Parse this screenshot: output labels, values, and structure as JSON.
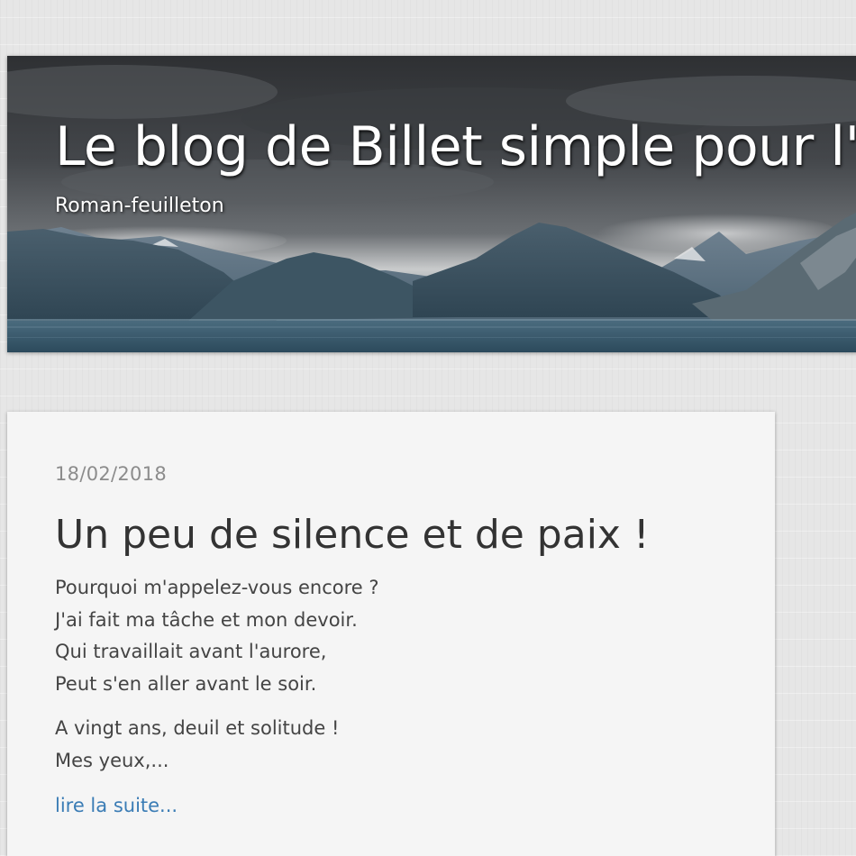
{
  "header": {
    "title": "Le blog de Billet simple pour l'Alaska",
    "subtitle": "Roman-feuilleton"
  },
  "post": {
    "date": "18/02/2018",
    "title": "Un peu de silence et de paix !",
    "stanza1": [
      "Pourquoi m'appelez-vous encore ?",
      "J'ai fait ma tâche et mon devoir.",
      "Qui travaillait avant l'aurore,",
      "Peut s'en aller avant le soir."
    ],
    "stanza2": [
      "A vingt ans, deuil et solitude !",
      "Mes yeux,..."
    ],
    "read_more": "lire la suite..."
  },
  "colors": {
    "page_background": "#e6e6e6",
    "card_background": "#f5f5f5",
    "title_text": "#333333",
    "body_text": "#444444",
    "date_text": "#8c8c8c",
    "link": "#3a7cb5"
  }
}
